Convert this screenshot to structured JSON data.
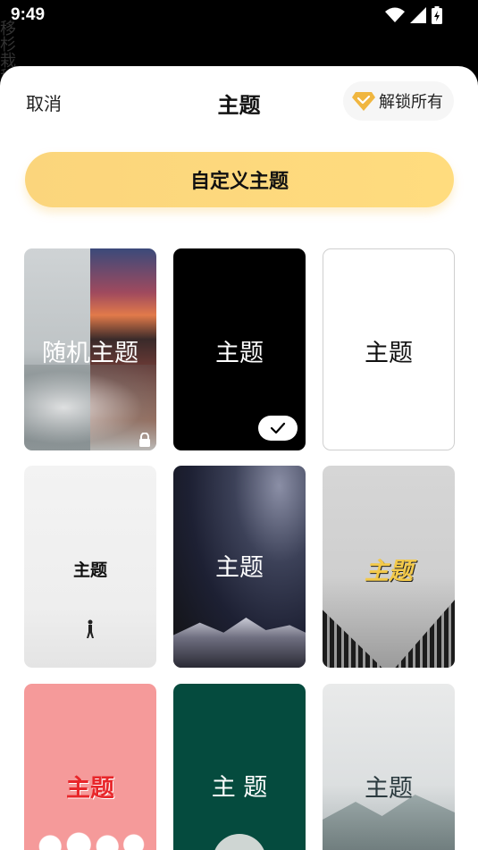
{
  "status_bar": {
    "time": "9:49"
  },
  "background_text": "移杉栽秘",
  "header": {
    "cancel_label": "取消",
    "title": "主题",
    "unlock_label": "解锁所有"
  },
  "custom_theme_button": "自定义主题",
  "themes": [
    {
      "label": "随机主题",
      "locked": true
    },
    {
      "label": "主题",
      "selected": true
    },
    {
      "label": "主题"
    },
    {
      "label": "主题"
    },
    {
      "label": "主题"
    },
    {
      "label": "主题"
    },
    {
      "label": "主题"
    },
    {
      "label": "主 题"
    },
    {
      "label": "主题"
    }
  ],
  "colors": {
    "accent": "#fbd57c",
    "selected_badge": "#ffffff"
  }
}
